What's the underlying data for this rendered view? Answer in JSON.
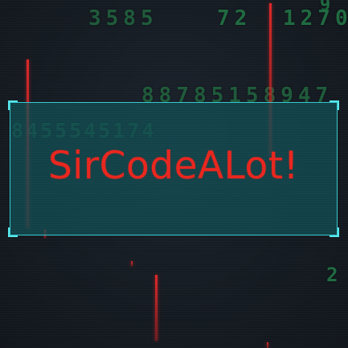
{
  "background": {
    "digit_rows": [
      "3585",
      "72",
      "1270",
      "9",
      "88785158947",
      "8455545174",
      "2"
    ]
  },
  "banner": {
    "title": "SirCodeALot!"
  },
  "colors": {
    "title": "#e8261e",
    "border": "#35c9cf",
    "panel": "#105056",
    "digits": "#1f6a40",
    "streaks": "#e62828"
  }
}
